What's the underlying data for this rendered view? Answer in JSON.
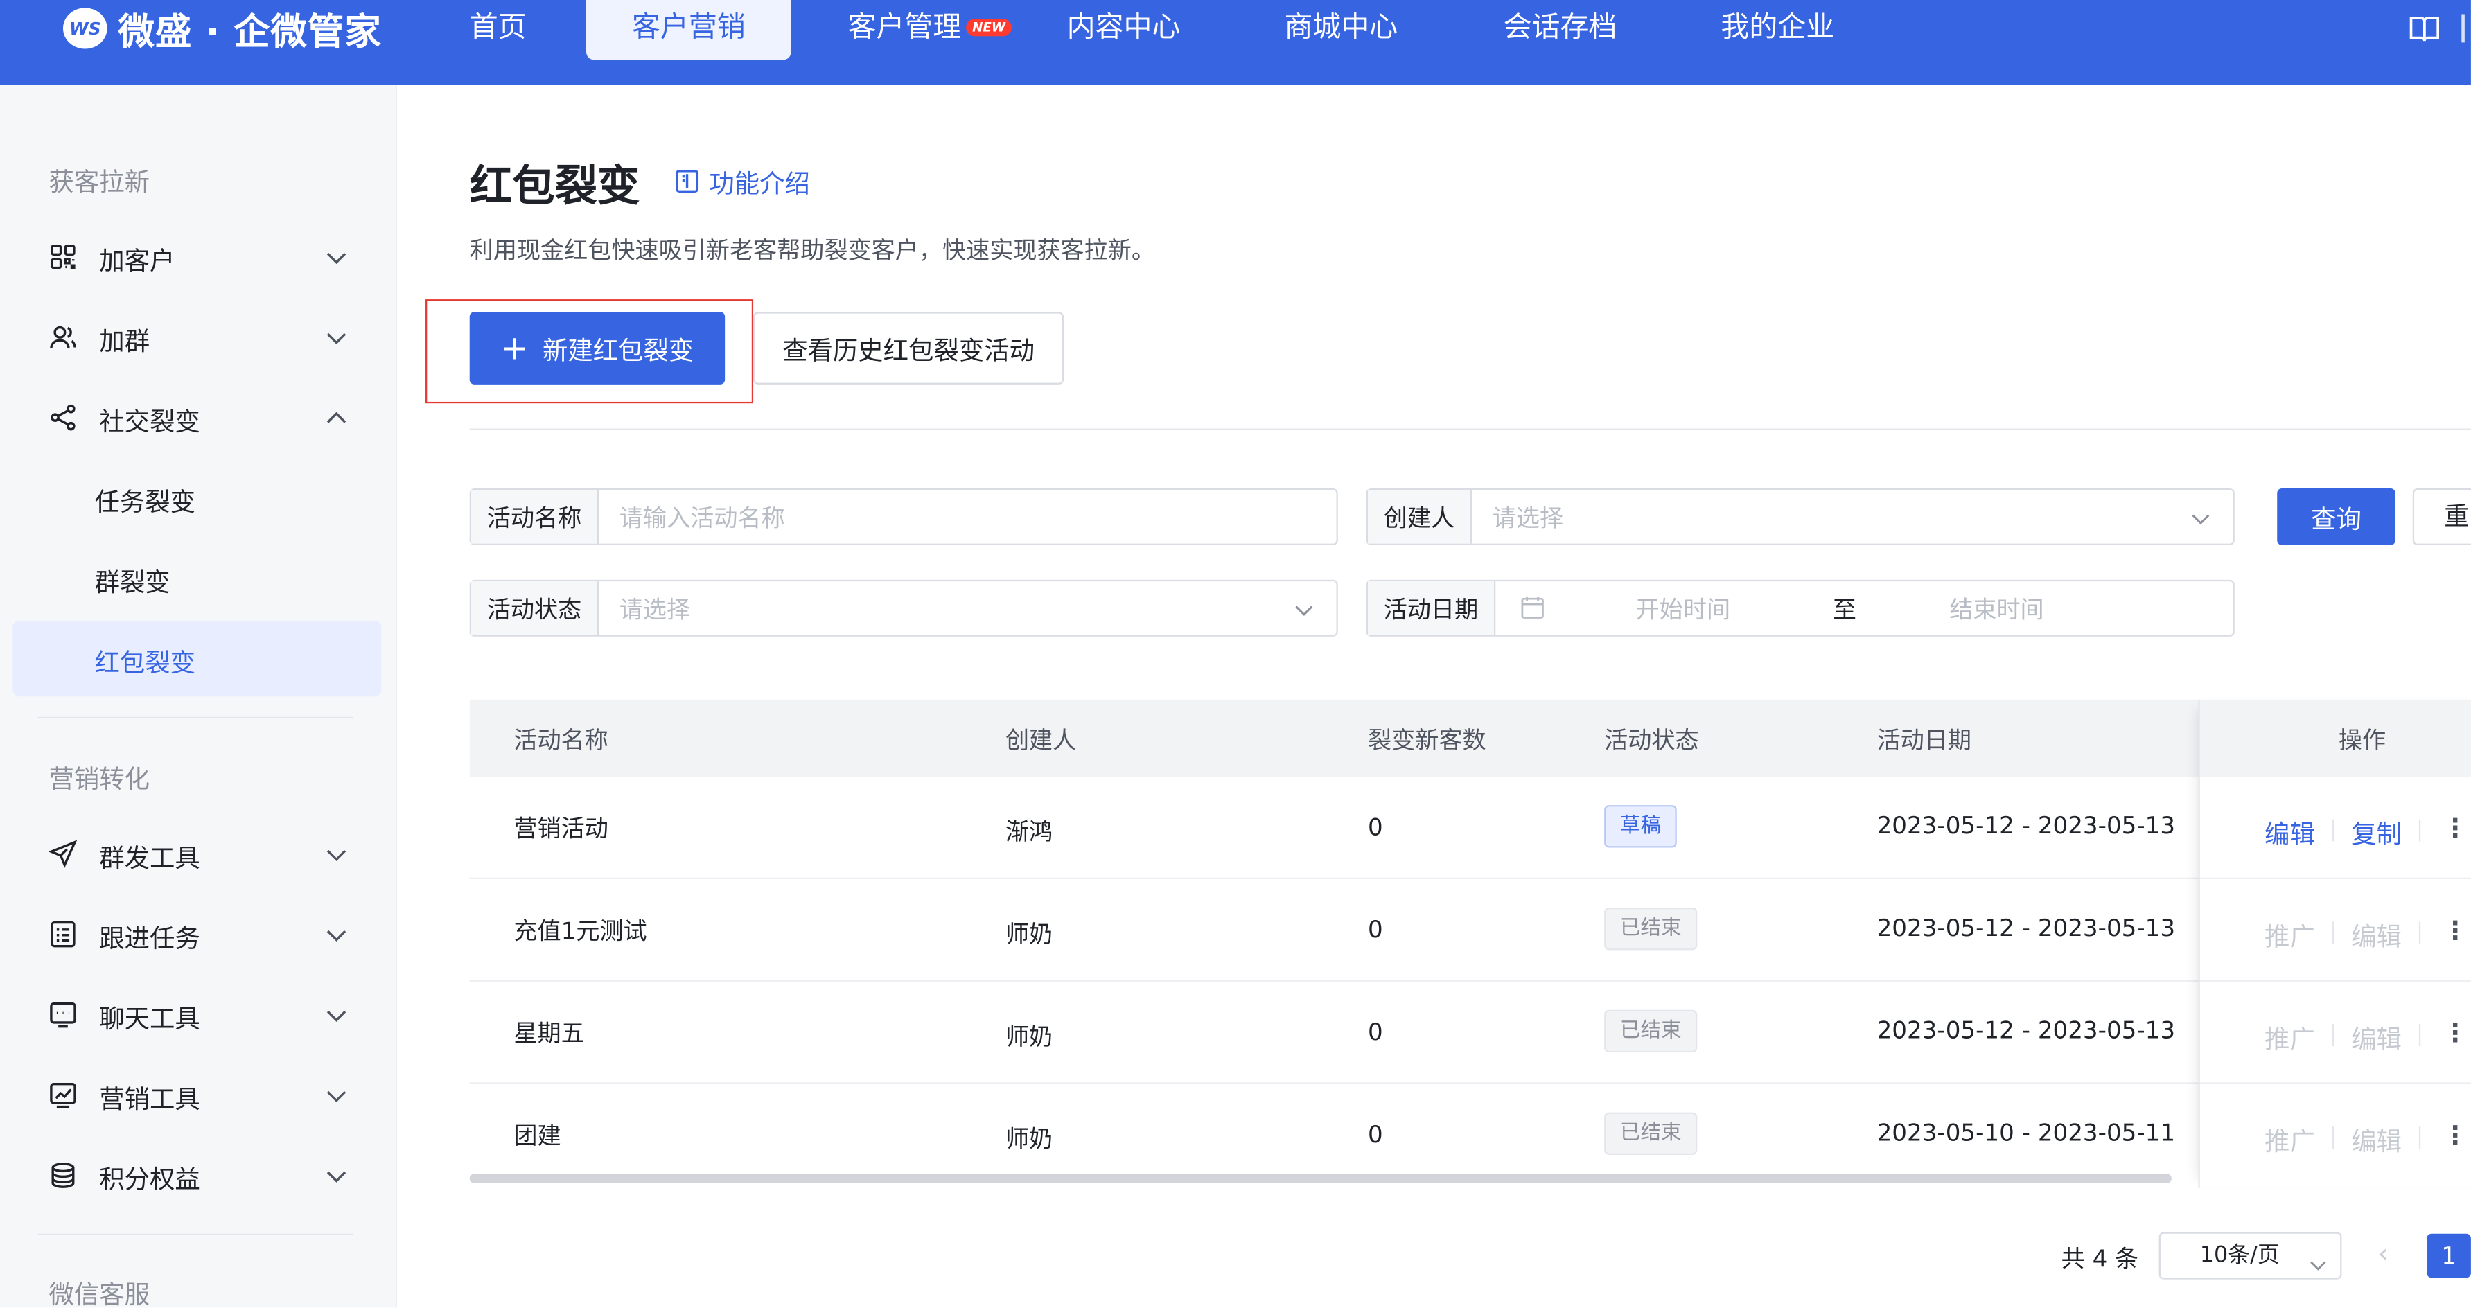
{
  "app": {
    "logo_badge": "WS",
    "logo_text": "微盛 · 企微管家"
  },
  "nav": {
    "items": [
      {
        "label": "首页"
      },
      {
        "label": "客户营销"
      },
      {
        "label": "客户管理",
        "badge": "NEW"
      },
      {
        "label": "内容中心"
      },
      {
        "label": "商城中心"
      },
      {
        "label": "会话存档"
      },
      {
        "label": "我的企业"
      }
    ],
    "active_index": 1
  },
  "sidebar": {
    "sections": [
      {
        "title": "获客拉新",
        "items": [
          {
            "label": "加客户",
            "icon": "grid-icon"
          },
          {
            "label": "加群",
            "icon": "user-group-icon"
          },
          {
            "label": "社交裂变",
            "icon": "share-icon",
            "expanded": true,
            "children": [
              {
                "label": "任务裂变"
              },
              {
                "label": "群裂变"
              },
              {
                "label": "红包裂变",
                "active": true
              }
            ]
          }
        ]
      },
      {
        "title": "营销转化",
        "items": [
          {
            "label": "群发工具",
            "icon": "send-icon"
          },
          {
            "label": "跟进任务",
            "icon": "checklist-icon"
          },
          {
            "label": "聊天工具",
            "icon": "chat-tool-icon"
          },
          {
            "label": "营销工具",
            "icon": "chart-icon"
          },
          {
            "label": "积分权益",
            "icon": "coins-icon"
          }
        ]
      },
      {
        "title": "微信客服"
      }
    ]
  },
  "page": {
    "title": "红包裂变",
    "intro_link": "功能介绍",
    "description": "利用现金红包快速吸引新老客帮助裂变客户，快速实现获客拉新。",
    "create_button": "新建红包裂变",
    "history_button": "查看历史红包裂变活动"
  },
  "filters": {
    "name_label": "活动名称",
    "name_placeholder": "请输入活动名称",
    "creator_label": "创建人",
    "creator_placeholder": "请选择",
    "status_label": "活动状态",
    "status_placeholder": "请选择",
    "date_label": "活动日期",
    "date_start_placeholder": "开始时间",
    "date_separator": "至",
    "date_end_placeholder": "结束时间",
    "query_button": "查询",
    "reset_button": "重"
  },
  "table": {
    "columns": [
      "活动名称",
      "创建人",
      "裂变新客数",
      "活动状态",
      "活动日期",
      "操作"
    ],
    "rows": [
      {
        "name": "营销活动",
        "creator": "渐鸿",
        "new_customers": "0",
        "status": "草稿",
        "status_type": "draft",
        "date": "2023-05-12 - 2023-05-13",
        "op1": "编辑",
        "op2": "复制",
        "ops_enabled": true
      },
      {
        "name": "充值1元测试",
        "creator": "师奶",
        "new_customers": "0",
        "status": "已结束",
        "status_type": "ended",
        "date": "2023-05-12 - 2023-05-13",
        "op1": "推广",
        "op2": "编辑",
        "ops_enabled": false
      },
      {
        "name": "星期五",
        "creator": "师奶",
        "new_customers": "0",
        "status": "已结束",
        "status_type": "ended",
        "date": "2023-05-12 - 2023-05-13",
        "op1": "推广",
        "op2": "编辑",
        "ops_enabled": false
      },
      {
        "name": "团建",
        "creator": "师奶",
        "new_customers": "0",
        "status": "已结束",
        "status_type": "ended",
        "date": "2023-05-10 - 2023-05-11",
        "op1": "推广",
        "op2": "编辑",
        "ops_enabled": false
      }
    ],
    "more_glyph": "⋮"
  },
  "pagination": {
    "total": "共 4 条",
    "page_size": "10条/页",
    "prev_glyph": "‹",
    "current_page": "1"
  },
  "colors": {
    "primary": "#3764e0",
    "highlight_border": "#e53935",
    "draft_tag": "#3764e0",
    "ended_tag": "#8a8f99"
  }
}
